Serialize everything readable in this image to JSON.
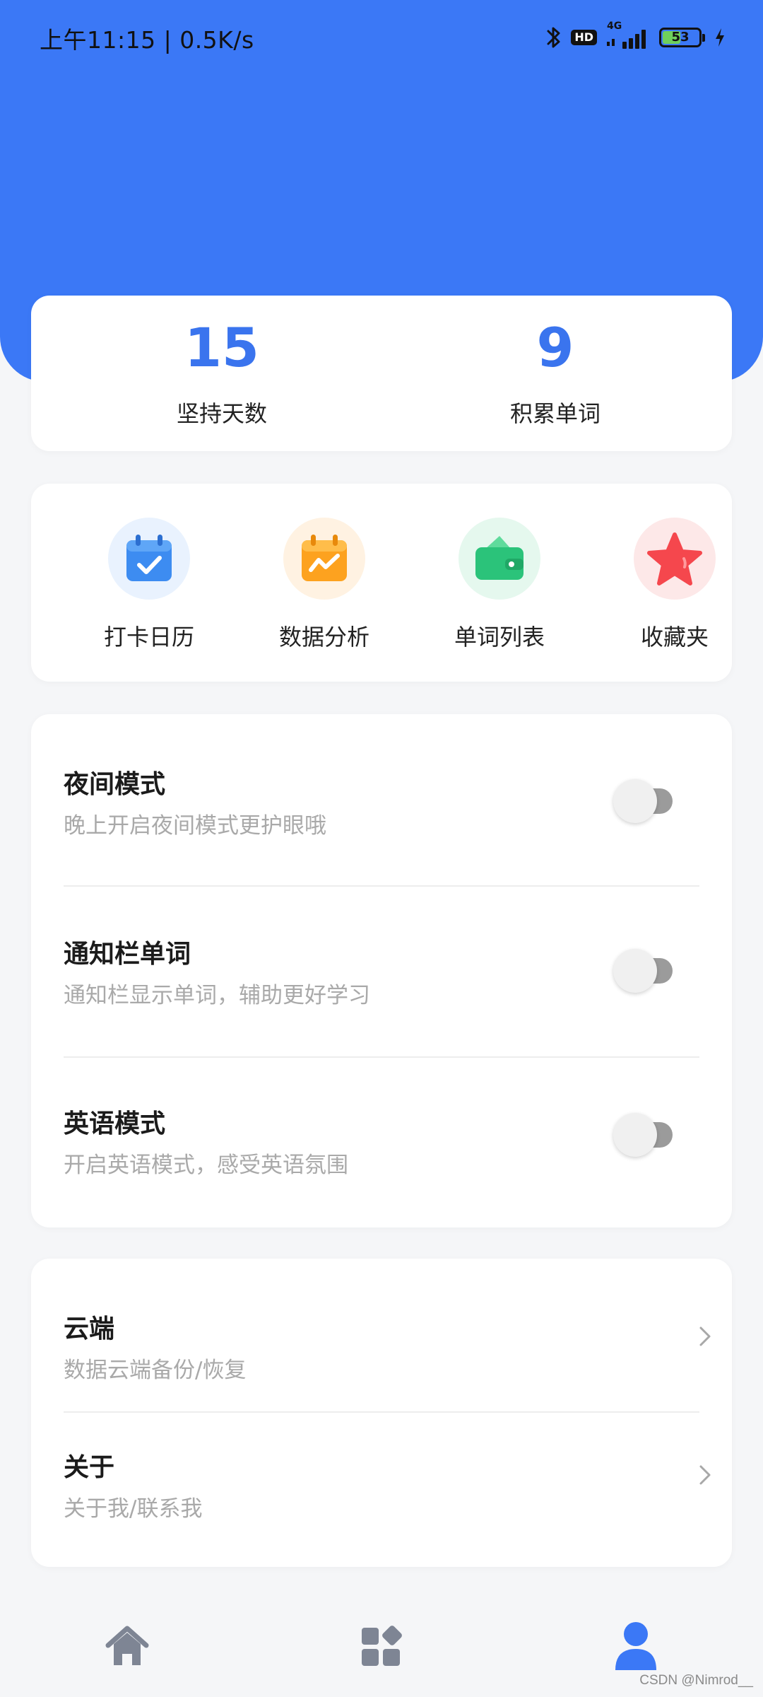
{
  "status_bar": {
    "time": "上午11:15 | 0.5K/s",
    "network": "4G",
    "hd": "HD",
    "battery_level": 53,
    "battery_text": "53"
  },
  "stats": {
    "days": {
      "value": "15",
      "label": "坚持天数"
    },
    "words": {
      "value": "9",
      "label": "积累单词"
    }
  },
  "quick_actions": [
    {
      "label": "打卡日历",
      "icon": "calendar-check-icon",
      "color": "#3d8cf1",
      "bg": "#e9f2fe"
    },
    {
      "label": "数据分析",
      "icon": "chart-calendar-icon",
      "color": "#fda21f",
      "bg": "#fff2e2"
    },
    {
      "label": "单词列表",
      "icon": "wallet-icon",
      "color": "#2bc37a",
      "bg": "#e5f8ee"
    },
    {
      "label": "收藏夹",
      "icon": "star-icon",
      "color": "#f5474d",
      "bg": "#fde8e8"
    }
  ],
  "toggle_settings": [
    {
      "title": "夜间模式",
      "subtitle": "晚上开启夜间模式更护眼哦",
      "enabled": false
    },
    {
      "title": "通知栏单词",
      "subtitle": "通知栏显示单词，辅助更好学习",
      "enabled": false
    },
    {
      "title": "英语模式",
      "subtitle": "开启英语模式，感受英语氛围",
      "enabled": false
    }
  ],
  "link_settings": [
    {
      "title": "云端",
      "subtitle": "数据云端备份/恢复"
    },
    {
      "title": "关于",
      "subtitle": "关于我/联系我"
    }
  ],
  "bottom_nav": [
    {
      "icon": "home-icon",
      "active": false
    },
    {
      "icon": "apps-icon",
      "active": false
    },
    {
      "icon": "profile-icon",
      "active": true
    }
  ],
  "colors": {
    "primary": "#3b78f6",
    "stat_value": "#3a74ee",
    "nav_inactive": "#7e8594",
    "nav_active": "#3b78f6"
  },
  "watermark": "CSDN @Nimrod__"
}
